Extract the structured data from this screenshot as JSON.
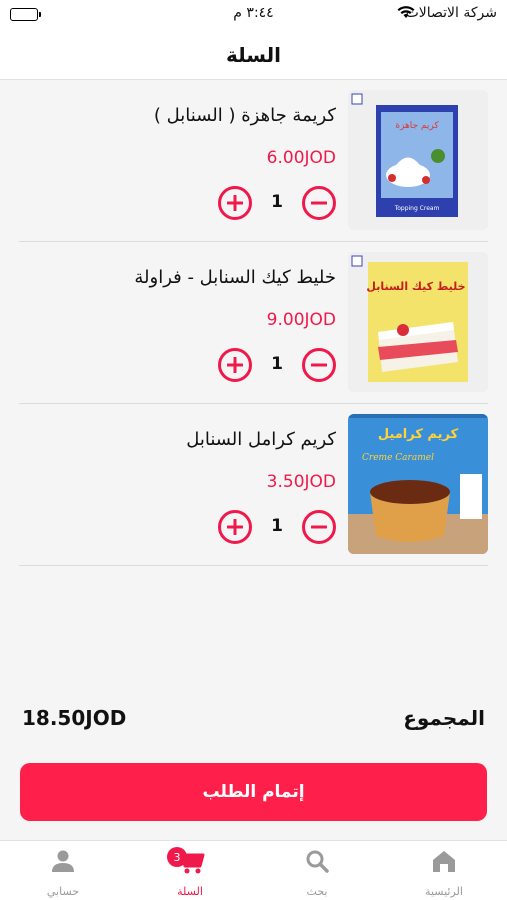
{
  "status_bar": {
    "carrier": "شركة الاتصالات",
    "time": "٣:٤٤ م"
  },
  "header": {
    "title": "السلة"
  },
  "cart": {
    "items": [
      {
        "name": "كريمة جاهزة ( السنابل )",
        "price": "6.00JOD",
        "quantity": "1",
        "image": "topping-cream-box",
        "image_text": "كريم جاهزة",
        "image_subtext": "Topping Cream"
      },
      {
        "name": "خليط كيك السنابل - فراولة",
        "price": "9.00JOD",
        "quantity": "1",
        "image": "cake-mix-box",
        "image_text": "خليط كيك السنابل",
        "image_subtext": ""
      },
      {
        "name": "كريم كرامل السنابل",
        "price": "3.50JOD",
        "quantity": "1",
        "image": "creme-caramel-box",
        "image_text": "كريم كراميل",
        "image_subtext": "Creme Caramel"
      }
    ]
  },
  "summary": {
    "total_label": "المجموع",
    "total_value": "18.50JOD"
  },
  "checkout": {
    "label": "إتمام الطلب"
  },
  "tab_bar": {
    "tabs": [
      {
        "label": "الرئيسية",
        "icon": "home-icon"
      },
      {
        "label": "بحث",
        "icon": "search-icon"
      },
      {
        "label": "السلة",
        "icon": "cart-icon",
        "badge": "3"
      },
      {
        "label": "حسابي",
        "icon": "user-icon"
      }
    ]
  },
  "colors": {
    "accent": "#f0194b",
    "button": "#ff1f4b",
    "background": "#f5f5f5"
  }
}
